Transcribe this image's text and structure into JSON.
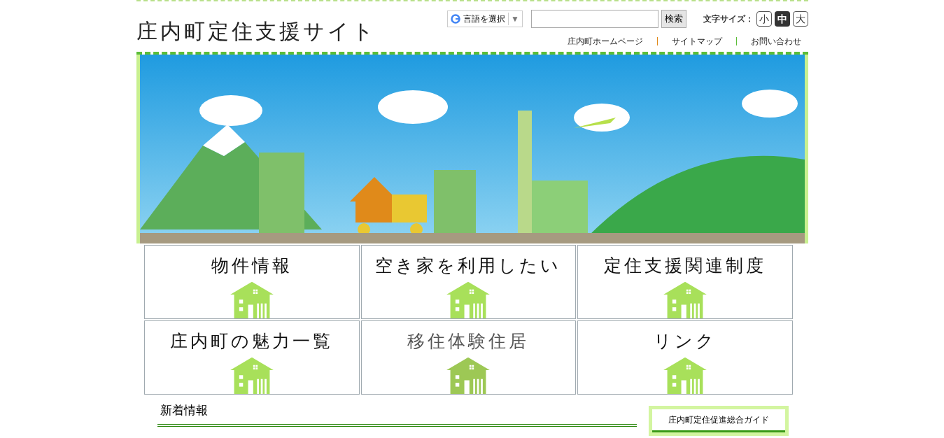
{
  "header": {
    "site_title": "庄内町定住支援サイト",
    "translate": {
      "label": "言語を選択",
      "caret": "▼"
    },
    "search": {
      "button": "検索"
    },
    "font_size": {
      "label": "文字サイズ：",
      "options": [
        {
          "label": "小",
          "selected": false
        },
        {
          "label": "中",
          "selected": true
        },
        {
          "label": "大",
          "selected": false
        }
      ]
    },
    "links": [
      "庄内町ホームページ",
      "サイトマップ",
      "お問い合わせ"
    ]
  },
  "menu_tiles": [
    {
      "label": "物件情報",
      "hovered": false
    },
    {
      "label": "空き家を利用したい",
      "hovered": false
    },
    {
      "label": "定住支援関連制度",
      "hovered": false
    },
    {
      "label": "庄内町の魅力一覧",
      "hovered": false
    },
    {
      "label": "移住体験住居",
      "hovered": true
    },
    {
      "label": "リンク",
      "hovered": false
    }
  ],
  "news": {
    "heading": "新着情報"
  },
  "sidebar": {
    "guide_title": "庄内町定住促進総合ガイド"
  }
}
